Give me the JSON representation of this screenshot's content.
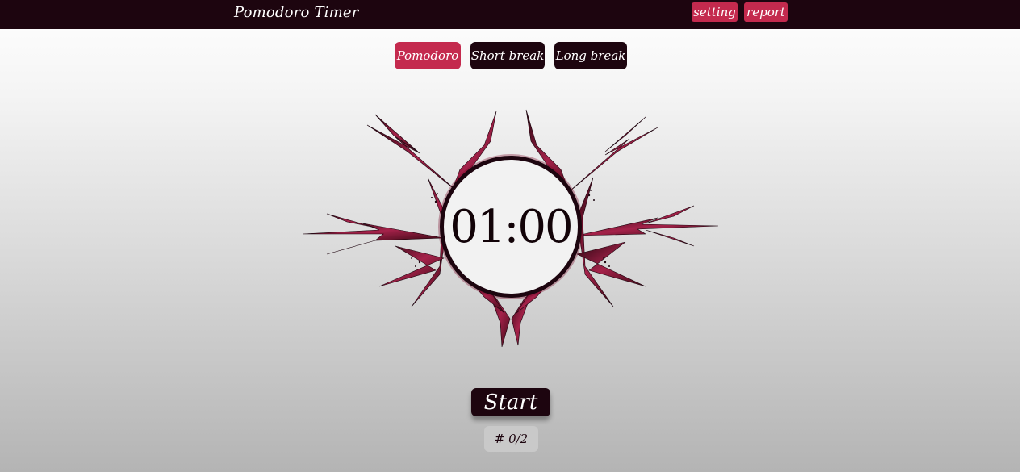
{
  "header": {
    "title": "Pomodoro Timer",
    "setting_label": "setting",
    "report_label": "report"
  },
  "modes": [
    {
      "label": "Pomodoro",
      "active": true
    },
    {
      "label": "Short break",
      "active": false
    },
    {
      "label": "Long break",
      "active": false
    }
  ],
  "timer": {
    "display": "01:00"
  },
  "controls": {
    "start_label": "Start",
    "session_counter": "# 0/2"
  },
  "colors": {
    "accent": "#c42a4e",
    "dark": "#1d050f",
    "emblem": "#8e1a3a"
  },
  "icons": {
    "decoration": "thorn-emblem-icon"
  }
}
